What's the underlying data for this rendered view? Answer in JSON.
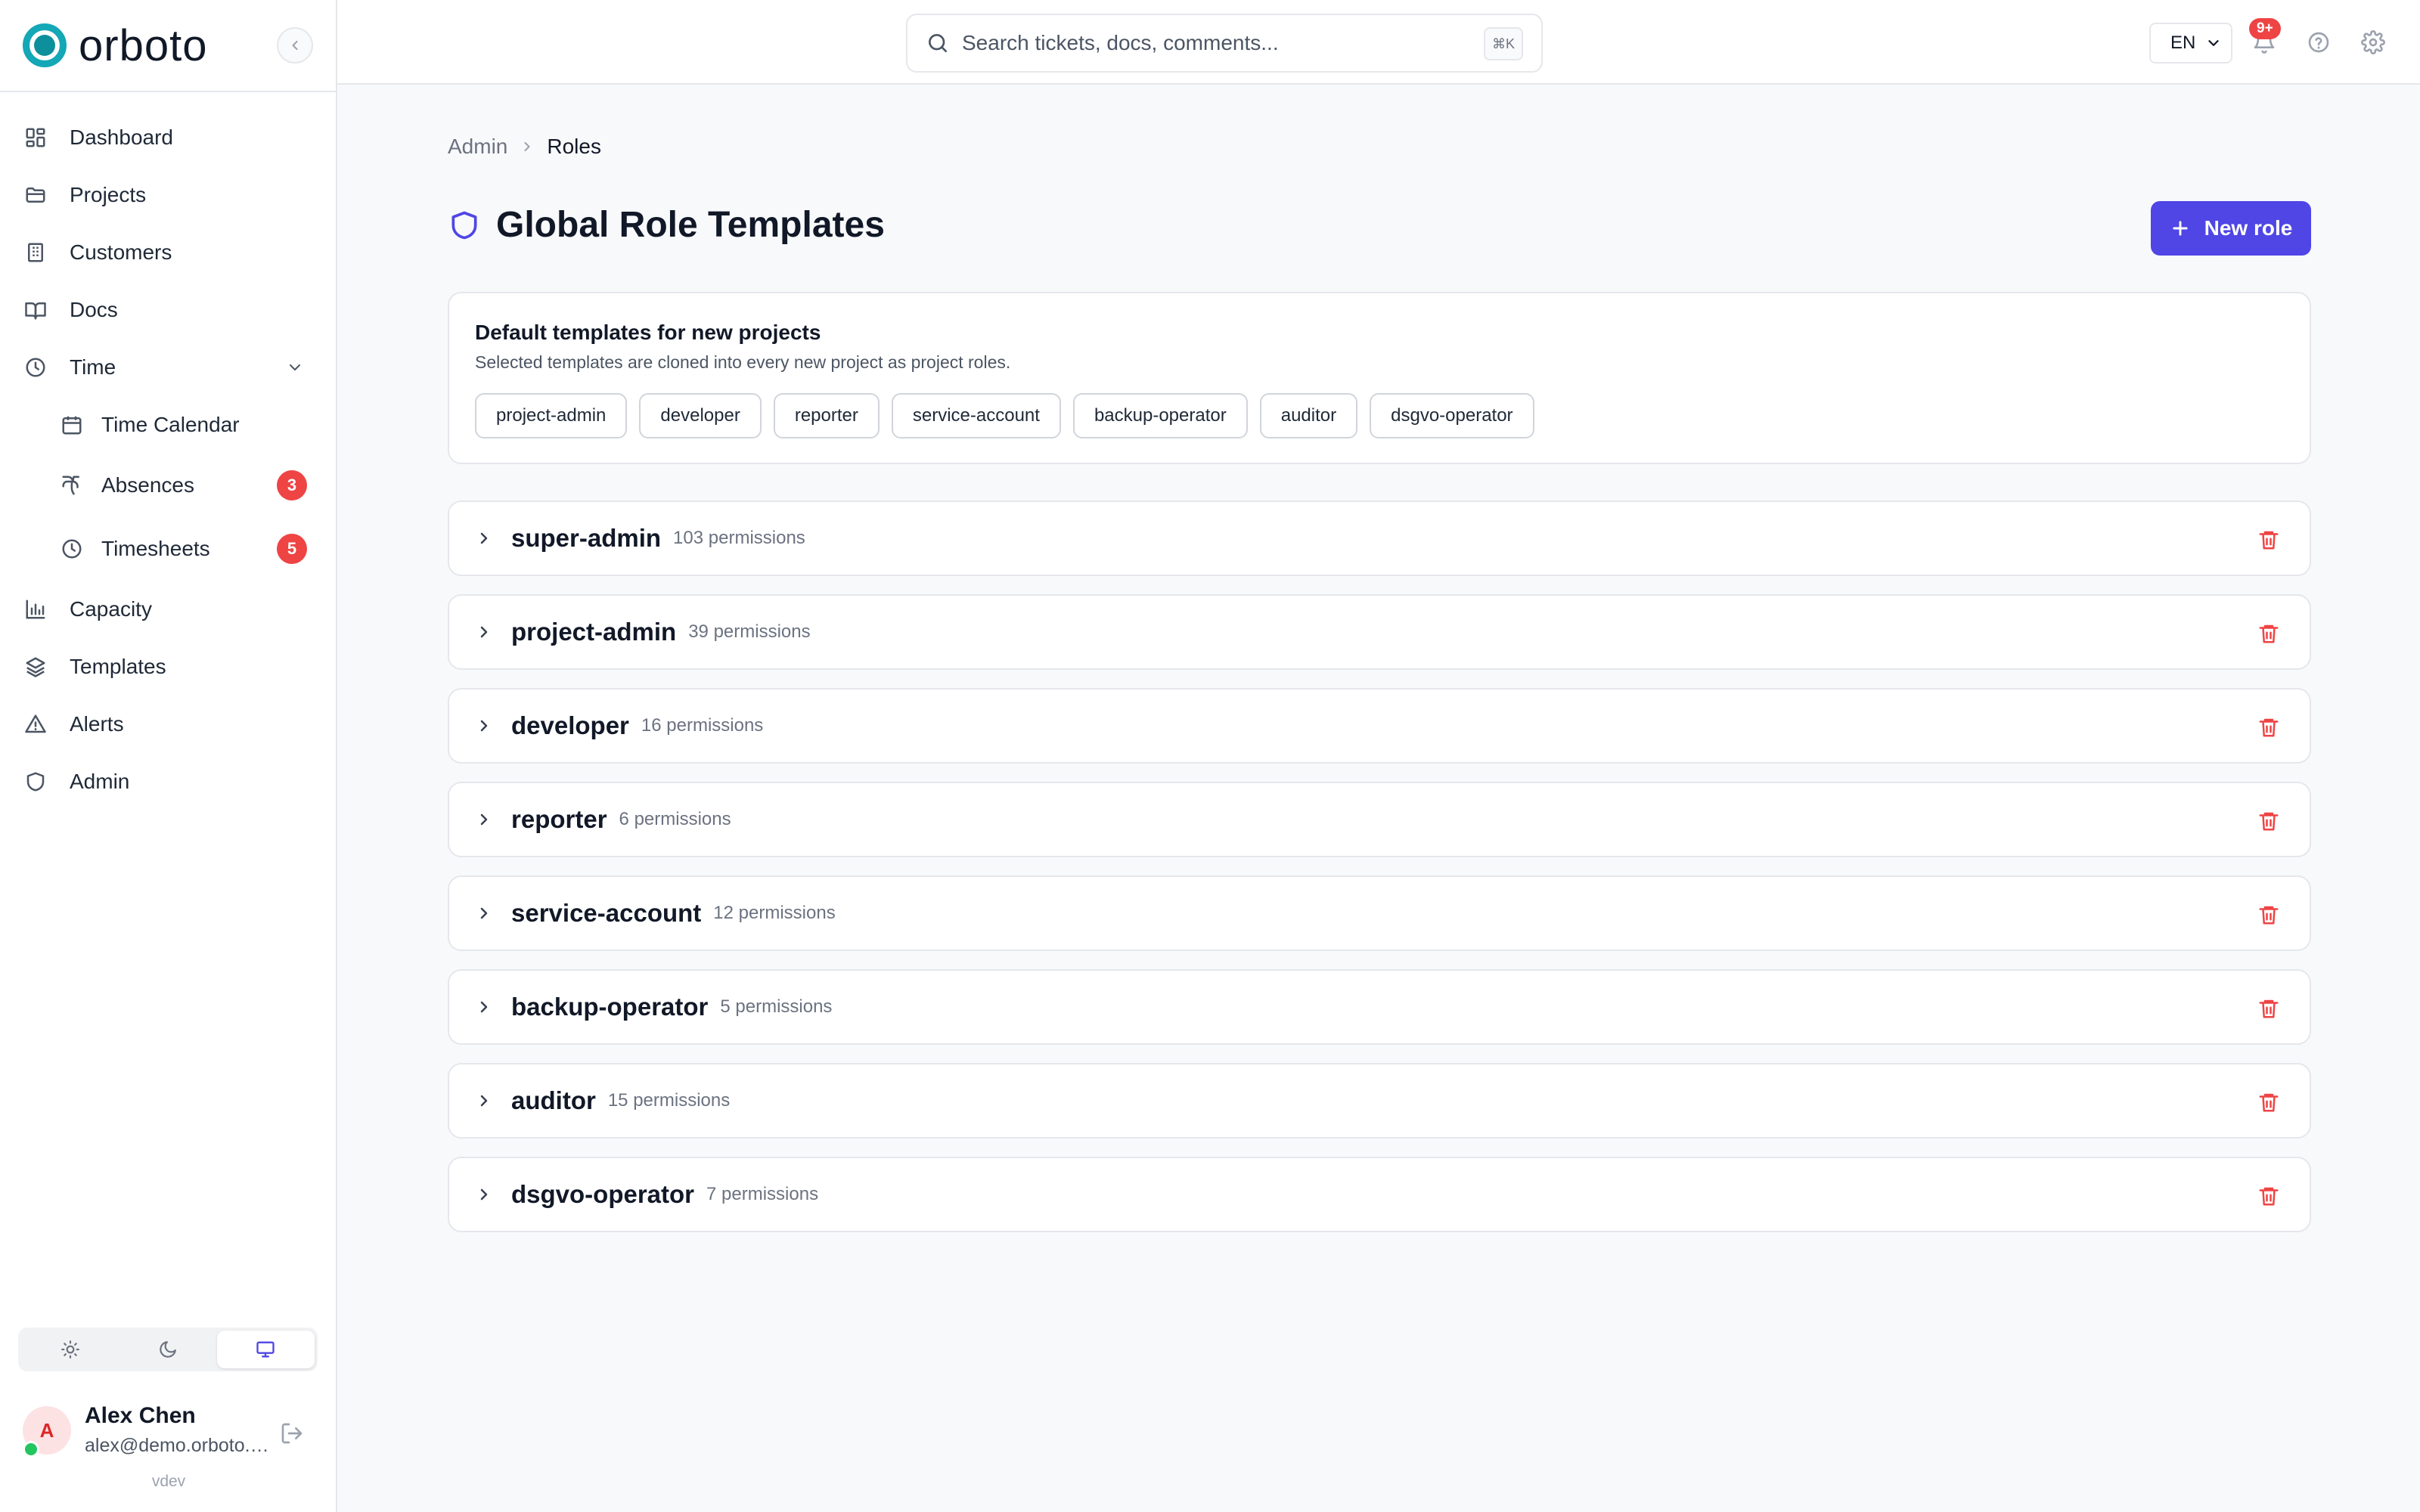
{
  "brand": {
    "name": "orboto"
  },
  "sidebar": {
    "items": [
      {
        "label": "Dashboard",
        "icon": "dashboard-icon"
      },
      {
        "label": "Projects",
        "icon": "folder-icon"
      },
      {
        "label": "Customers",
        "icon": "building-icon"
      },
      {
        "label": "Docs",
        "icon": "book-icon"
      },
      {
        "label": "Time",
        "icon": "clock-icon",
        "expanded": true
      },
      {
        "label": "Time Calendar",
        "icon": "calendar-icon"
      },
      {
        "label": "Absences",
        "icon": "palm-tree-icon",
        "badge": "3"
      },
      {
        "label": "Timesheets",
        "icon": "clock-icon",
        "badge": "5"
      },
      {
        "label": "Capacity",
        "icon": "bar-chart-icon"
      },
      {
        "label": "Templates",
        "icon": "layers-icon"
      },
      {
        "label": "Alerts",
        "icon": "alert-triangle-icon"
      },
      {
        "label": "Admin",
        "icon": "shield-icon"
      }
    ],
    "theme": {
      "options": [
        "sun-icon",
        "moon-icon",
        "monitor-icon"
      ],
      "active": "monitor-icon"
    },
    "user": {
      "initial": "A",
      "name": "Alex Chen",
      "email": "alex@demo.orboto.com"
    },
    "version": "vdev"
  },
  "topbar": {
    "search_placeholder": "Search tickets, docs, comments...",
    "shortcut": "⌘K",
    "language": "EN",
    "notification_count": "9+"
  },
  "breadcrumb": {
    "parent": "Admin",
    "current": "Roles"
  },
  "page": {
    "title": "Global Role Templates",
    "new_role_label": "New role"
  },
  "defaults": {
    "title": "Default templates for new projects",
    "subtitle": "Selected templates are cloned into every new project as project roles.",
    "chips": [
      "project-admin",
      "developer",
      "reporter",
      "service-account",
      "backup-operator",
      "auditor",
      "dsgvo-operator"
    ]
  },
  "roles": [
    {
      "name": "super-admin",
      "permissions": "103 permissions"
    },
    {
      "name": "project-admin",
      "permissions": "39 permissions"
    },
    {
      "name": "developer",
      "permissions": "16 permissions"
    },
    {
      "name": "reporter",
      "permissions": "6 permissions"
    },
    {
      "name": "service-account",
      "permissions": "12 permissions"
    },
    {
      "name": "backup-operator",
      "permissions": "5 permissions"
    },
    {
      "name": "auditor",
      "permissions": "15 permissions"
    },
    {
      "name": "dsgvo-operator",
      "permissions": "7 permissions"
    }
  ],
  "colors": {
    "accent": "#4f46e5",
    "brand": "#14a7b6",
    "danger": "#ef4444"
  }
}
